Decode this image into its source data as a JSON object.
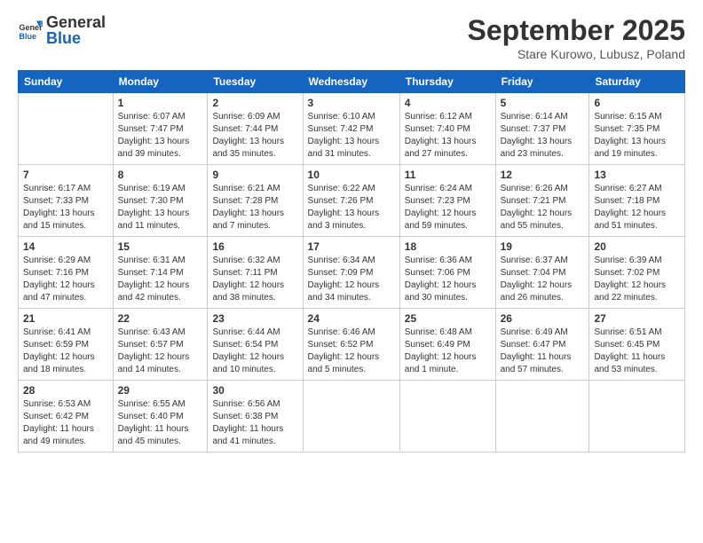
{
  "logo": {
    "general": "General",
    "blue": "Blue"
  },
  "title": "September 2025",
  "subtitle": "Stare Kurowo, Lubusz, Poland",
  "headers": [
    "Sunday",
    "Monday",
    "Tuesday",
    "Wednesday",
    "Thursday",
    "Friday",
    "Saturday"
  ],
  "weeks": [
    [
      {
        "day": "",
        "info": ""
      },
      {
        "day": "1",
        "info": "Sunrise: 6:07 AM\nSunset: 7:47 PM\nDaylight: 13 hours\nand 39 minutes."
      },
      {
        "day": "2",
        "info": "Sunrise: 6:09 AM\nSunset: 7:44 PM\nDaylight: 13 hours\nand 35 minutes."
      },
      {
        "day": "3",
        "info": "Sunrise: 6:10 AM\nSunset: 7:42 PM\nDaylight: 13 hours\nand 31 minutes."
      },
      {
        "day": "4",
        "info": "Sunrise: 6:12 AM\nSunset: 7:40 PM\nDaylight: 13 hours\nand 27 minutes."
      },
      {
        "day": "5",
        "info": "Sunrise: 6:14 AM\nSunset: 7:37 PM\nDaylight: 13 hours\nand 23 minutes."
      },
      {
        "day": "6",
        "info": "Sunrise: 6:15 AM\nSunset: 7:35 PM\nDaylight: 13 hours\nand 19 minutes."
      }
    ],
    [
      {
        "day": "7",
        "info": "Sunrise: 6:17 AM\nSunset: 7:33 PM\nDaylight: 13 hours\nand 15 minutes."
      },
      {
        "day": "8",
        "info": "Sunrise: 6:19 AM\nSunset: 7:30 PM\nDaylight: 13 hours\nand 11 minutes."
      },
      {
        "day": "9",
        "info": "Sunrise: 6:21 AM\nSunset: 7:28 PM\nDaylight: 13 hours\nand 7 minutes."
      },
      {
        "day": "10",
        "info": "Sunrise: 6:22 AM\nSunset: 7:26 PM\nDaylight: 13 hours\nand 3 minutes."
      },
      {
        "day": "11",
        "info": "Sunrise: 6:24 AM\nSunset: 7:23 PM\nDaylight: 12 hours\nand 59 minutes."
      },
      {
        "day": "12",
        "info": "Sunrise: 6:26 AM\nSunset: 7:21 PM\nDaylight: 12 hours\nand 55 minutes."
      },
      {
        "day": "13",
        "info": "Sunrise: 6:27 AM\nSunset: 7:18 PM\nDaylight: 12 hours\nand 51 minutes."
      }
    ],
    [
      {
        "day": "14",
        "info": "Sunrise: 6:29 AM\nSunset: 7:16 PM\nDaylight: 12 hours\nand 47 minutes."
      },
      {
        "day": "15",
        "info": "Sunrise: 6:31 AM\nSunset: 7:14 PM\nDaylight: 12 hours\nand 42 minutes."
      },
      {
        "day": "16",
        "info": "Sunrise: 6:32 AM\nSunset: 7:11 PM\nDaylight: 12 hours\nand 38 minutes."
      },
      {
        "day": "17",
        "info": "Sunrise: 6:34 AM\nSunset: 7:09 PM\nDaylight: 12 hours\nand 34 minutes."
      },
      {
        "day": "18",
        "info": "Sunrise: 6:36 AM\nSunset: 7:06 PM\nDaylight: 12 hours\nand 30 minutes."
      },
      {
        "day": "19",
        "info": "Sunrise: 6:37 AM\nSunset: 7:04 PM\nDaylight: 12 hours\nand 26 minutes."
      },
      {
        "day": "20",
        "info": "Sunrise: 6:39 AM\nSunset: 7:02 PM\nDaylight: 12 hours\nand 22 minutes."
      }
    ],
    [
      {
        "day": "21",
        "info": "Sunrise: 6:41 AM\nSunset: 6:59 PM\nDaylight: 12 hours\nand 18 minutes."
      },
      {
        "day": "22",
        "info": "Sunrise: 6:43 AM\nSunset: 6:57 PM\nDaylight: 12 hours\nand 14 minutes."
      },
      {
        "day": "23",
        "info": "Sunrise: 6:44 AM\nSunset: 6:54 PM\nDaylight: 12 hours\nand 10 minutes."
      },
      {
        "day": "24",
        "info": "Sunrise: 6:46 AM\nSunset: 6:52 PM\nDaylight: 12 hours\nand 5 minutes."
      },
      {
        "day": "25",
        "info": "Sunrise: 6:48 AM\nSunset: 6:49 PM\nDaylight: 12 hours\nand 1 minute."
      },
      {
        "day": "26",
        "info": "Sunrise: 6:49 AM\nSunset: 6:47 PM\nDaylight: 11 hours\nand 57 minutes."
      },
      {
        "day": "27",
        "info": "Sunrise: 6:51 AM\nSunset: 6:45 PM\nDaylight: 11 hours\nand 53 minutes."
      }
    ],
    [
      {
        "day": "28",
        "info": "Sunrise: 6:53 AM\nSunset: 6:42 PM\nDaylight: 11 hours\nand 49 minutes."
      },
      {
        "day": "29",
        "info": "Sunrise: 6:55 AM\nSunset: 6:40 PM\nDaylight: 11 hours\nand 45 minutes."
      },
      {
        "day": "30",
        "info": "Sunrise: 6:56 AM\nSunset: 6:38 PM\nDaylight: 11 hours\nand 41 minutes."
      },
      {
        "day": "",
        "info": ""
      },
      {
        "day": "",
        "info": ""
      },
      {
        "day": "",
        "info": ""
      },
      {
        "day": "",
        "info": ""
      }
    ]
  ]
}
